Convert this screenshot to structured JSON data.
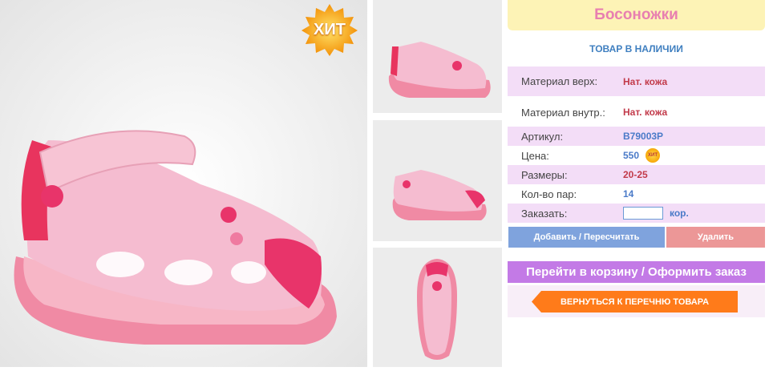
{
  "badge": {
    "hit_label": "ХИТ"
  },
  "product": {
    "title": "Босоножки",
    "availability": "ТОВАР В НАЛИЧИИ",
    "rows": [
      {
        "label": "Материал верх:",
        "value": "Нат. кожа"
      },
      {
        "label": "Материал внутр.:",
        "value": "Нат. кожа"
      },
      {
        "label": "Артикул:",
        "value": "B79003P"
      },
      {
        "label": "Цена:",
        "value": "550",
        "badge": "ХИТ"
      },
      {
        "label": "Размеры:",
        "value": "20-25"
      },
      {
        "label": "Кол-во пар:",
        "value": "14"
      }
    ],
    "order": {
      "label": "Заказать:",
      "input_value": "",
      "unit": "кор."
    }
  },
  "actions": {
    "recalc": "Добавить / Пересчитать",
    "delete": "Удалить",
    "cart": "Перейти в корзину / Оформить заказ",
    "back": "ВЕРНУТЬСЯ К ПЕРЕЧНЮ ТОВАРА"
  },
  "colors": {
    "accent_pink": "#e87fb0",
    "title_bg": "#fdf3b6",
    "row_bg": "#f3ddf7",
    "recalc_btn": "#7fa3dd",
    "delete_btn": "#ec9797",
    "cart_btn": "#c37ae6",
    "back_btn": "#ff7b1a"
  }
}
